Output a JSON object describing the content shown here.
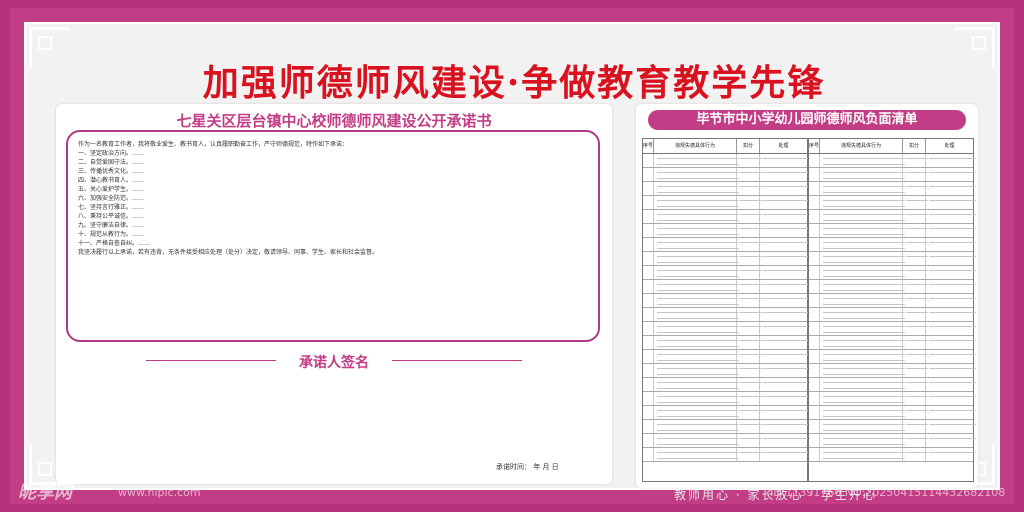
{
  "headline": "加强师德师风建设·争做教育教学先锋",
  "left_title": "七星关区层台镇中心校师德师风建设公开承诺书",
  "pledge_intro": "作为一名教育工作者，我将敬业爱生、教书育人，认真履职勤奋工作，严守师德规范，特作如下承诺：",
  "pledge_items": [
    "一、坚定政治方向。……",
    "二、自觉爱国守法。……",
    "三、传播优秀文化。……",
    "四、潜心教书育人。……",
    "五、关心爱护学生。……",
    "六、加强安全防范。……",
    "七、坚持言行雅正。……",
    "八、秉持公平诚信。……",
    "九、坚守廉洁自律。……",
    "十、规范从教行为。……",
    "十一、严格自查自纠。……"
  ],
  "pledge_close": "我坚决履行以上承诺，若有违背，无条件接受相应处理（处分）决定，敬请领导、同事、学生、家长和社会监督。",
  "sign_label": "承诺人签名",
  "date_label": "承诺时间：      年   月   日",
  "right_title": "毕节市中小学幼儿园师德师风负面清单",
  "table_left": {
    "headers": [
      "序号",
      "违规失德具体行为",
      "扣分",
      "处理"
    ],
    "row_count": 22
  },
  "table_right": {
    "headers": [
      "序号",
      "违规失德具体行为",
      "扣分",
      "处理"
    ],
    "row_count": 22
  },
  "slogan": "教师用心 · 家长放心 · 学生开心",
  "watermark": {
    "site": "昵享网",
    "url": "www.nipic.com",
    "id": "ID:11391760 NO:20250415114432682108"
  },
  "colors": {
    "frame": "#c23d86",
    "headline": "#d8121e",
    "panel": "#ffffff"
  }
}
